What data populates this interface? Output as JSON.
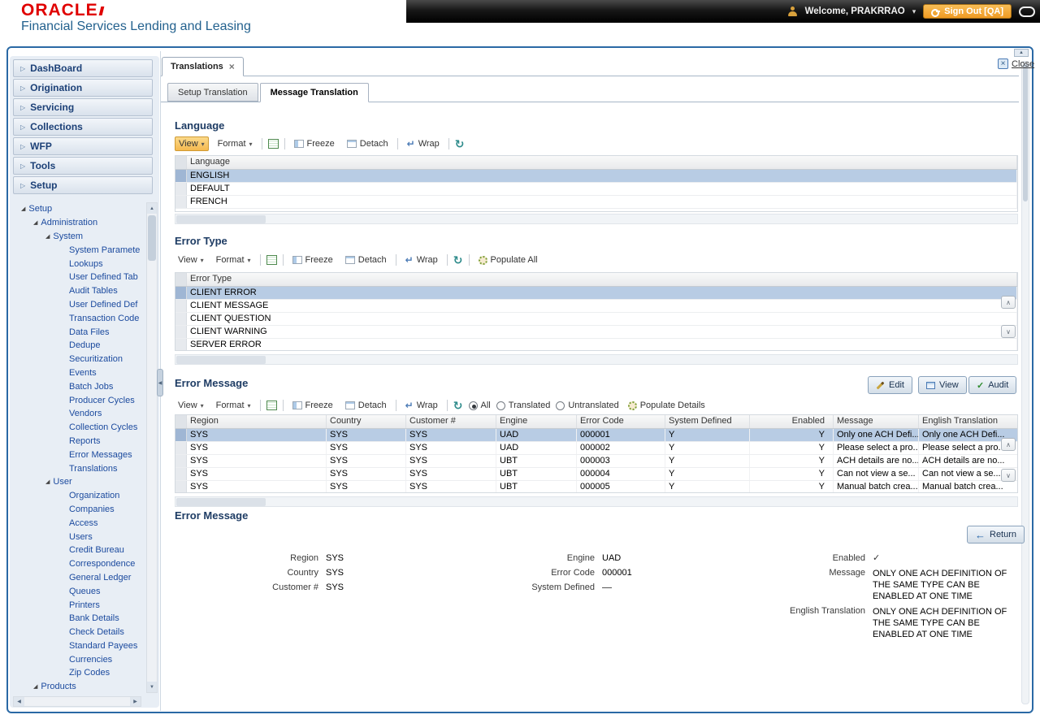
{
  "header": {
    "brand": "ORACLE",
    "product": "Financial Services Lending and Leasing",
    "welcome": "Welcome, PRAKRRAO",
    "sign_out": "Sign Out [QA]"
  },
  "sidebar": {
    "menu": [
      "DashBoard",
      "Origination",
      "Servicing",
      "Collections",
      "WFP",
      "Tools",
      "Setup"
    ],
    "tree": [
      {
        "label": "Setup",
        "level": 0,
        "parent": true
      },
      {
        "label": "Administration",
        "level": 1,
        "parent": true
      },
      {
        "label": "System",
        "level": 2,
        "parent": true
      },
      {
        "label": "System Paramete",
        "level": 3
      },
      {
        "label": "Lookups",
        "level": 3
      },
      {
        "label": "User Defined Tab",
        "level": 3
      },
      {
        "label": "Audit Tables",
        "level": 3
      },
      {
        "label": "User Defined Def",
        "level": 3
      },
      {
        "label": "Transaction Code",
        "level": 3
      },
      {
        "label": "Data Files",
        "level": 3
      },
      {
        "label": "Dedupe",
        "level": 3
      },
      {
        "label": "Securitization",
        "level": 3
      },
      {
        "label": "Events",
        "level": 3
      },
      {
        "label": "Batch Jobs",
        "level": 3
      },
      {
        "label": "Producer Cycles",
        "level": 3
      },
      {
        "label": "Vendors",
        "level": 3
      },
      {
        "label": "Collection Cycles",
        "level": 3
      },
      {
        "label": "Reports",
        "level": 3
      },
      {
        "label": "Error Messages",
        "level": 3
      },
      {
        "label": "Translations",
        "level": 3
      },
      {
        "label": "User",
        "level": 2,
        "parent": true
      },
      {
        "label": "Organization",
        "level": 3
      },
      {
        "label": "Companies",
        "level": 3
      },
      {
        "label": "Access",
        "level": 3
      },
      {
        "label": "Users",
        "level": 3
      },
      {
        "label": "Credit Bureau",
        "level": 3
      },
      {
        "label": "Correspondence",
        "level": 3
      },
      {
        "label": "General Ledger",
        "level": 3
      },
      {
        "label": "Queues",
        "level": 3
      },
      {
        "label": "Printers",
        "level": 3
      },
      {
        "label": "Bank Details",
        "level": 3
      },
      {
        "label": "Check Details",
        "level": 3
      },
      {
        "label": "Standard Payees",
        "level": 3
      },
      {
        "label": "Currencies",
        "level": 3
      },
      {
        "label": "Zip Codes",
        "level": 3
      },
      {
        "label": "Products",
        "level": 1,
        "parent": true
      }
    ]
  },
  "workspace": {
    "tab": "Translations",
    "close": "Close",
    "subtabs": [
      "Setup Translation",
      "Message Translation"
    ],
    "active_subtab": 1
  },
  "toolbar": {
    "view": "View",
    "format": "Format",
    "freeze": "Freeze",
    "detach": "Detach",
    "wrap": "Wrap"
  },
  "language": {
    "title": "Language",
    "columns": [
      "Language"
    ],
    "rows": [
      "ENGLISH",
      "DEFAULT",
      "FRENCH"
    ],
    "selected_index": 0
  },
  "error_type": {
    "title": "Error Type",
    "populate_all": "Populate All",
    "columns": [
      "Error Type"
    ],
    "rows": [
      "CLIENT ERROR",
      "CLIENT MESSAGE",
      "CLIENT QUESTION",
      "CLIENT WARNING",
      "SERVER ERROR"
    ],
    "selected_index": 0
  },
  "error_message": {
    "title": "Error Message",
    "actions": {
      "edit": "Edit",
      "view": "View",
      "audit": "Audit"
    },
    "filters": [
      "All",
      "Translated",
      "Untranslated"
    ],
    "selected_filter": 0,
    "populate_details": "Populate Details",
    "columns": [
      "Region",
      "Country",
      "Customer #",
      "Engine",
      "Error Code",
      "System Defined",
      "Enabled",
      "Message",
      "English Translation"
    ],
    "rows": [
      [
        "SYS",
        "SYS",
        "SYS",
        "UAD",
        "000001",
        "Y",
        "Y",
        "Only one ACH Defi...",
        "Only one ACH Defi..."
      ],
      [
        "SYS",
        "SYS",
        "SYS",
        "UAD",
        "000002",
        "Y",
        "Y",
        "Please select a pro...",
        "Please select a pro..."
      ],
      [
        "SYS",
        "SYS",
        "SYS",
        "UBT",
        "000003",
        "Y",
        "Y",
        "ACH details are no...",
        "ACH details are no..."
      ],
      [
        "SYS",
        "SYS",
        "SYS",
        "UBT",
        "000004",
        "Y",
        "Y",
        "Can not view a se...",
        "Can not view a se..."
      ],
      [
        "SYS",
        "SYS",
        "SYS",
        "UBT",
        "000005",
        "Y",
        "Y",
        "Manual batch crea...",
        "Manual batch crea..."
      ]
    ],
    "selected_index": 0
  },
  "detail": {
    "title": "Error Message",
    "return_label": "Return",
    "labels": {
      "region": "Region",
      "country": "Country",
      "customer": "Customer #",
      "engine": "Engine",
      "error_code": "Error Code",
      "system_defined": "System Defined",
      "enabled": "Enabled",
      "message": "Message",
      "english": "English Translation"
    },
    "values": {
      "region": "SYS",
      "country": "SYS",
      "customer": "SYS",
      "engine": "UAD",
      "error_code": "000001",
      "system_defined": false,
      "enabled": true,
      "message": "ONLY ONE ACH DEFINITION OF THE SAME TYPE CAN BE ENABLED AT ONE TIME",
      "english": "ONLY ONE ACH DEFINITION OF THE SAME TYPE CAN BE ENABLED AT ONE TIME"
    }
  }
}
